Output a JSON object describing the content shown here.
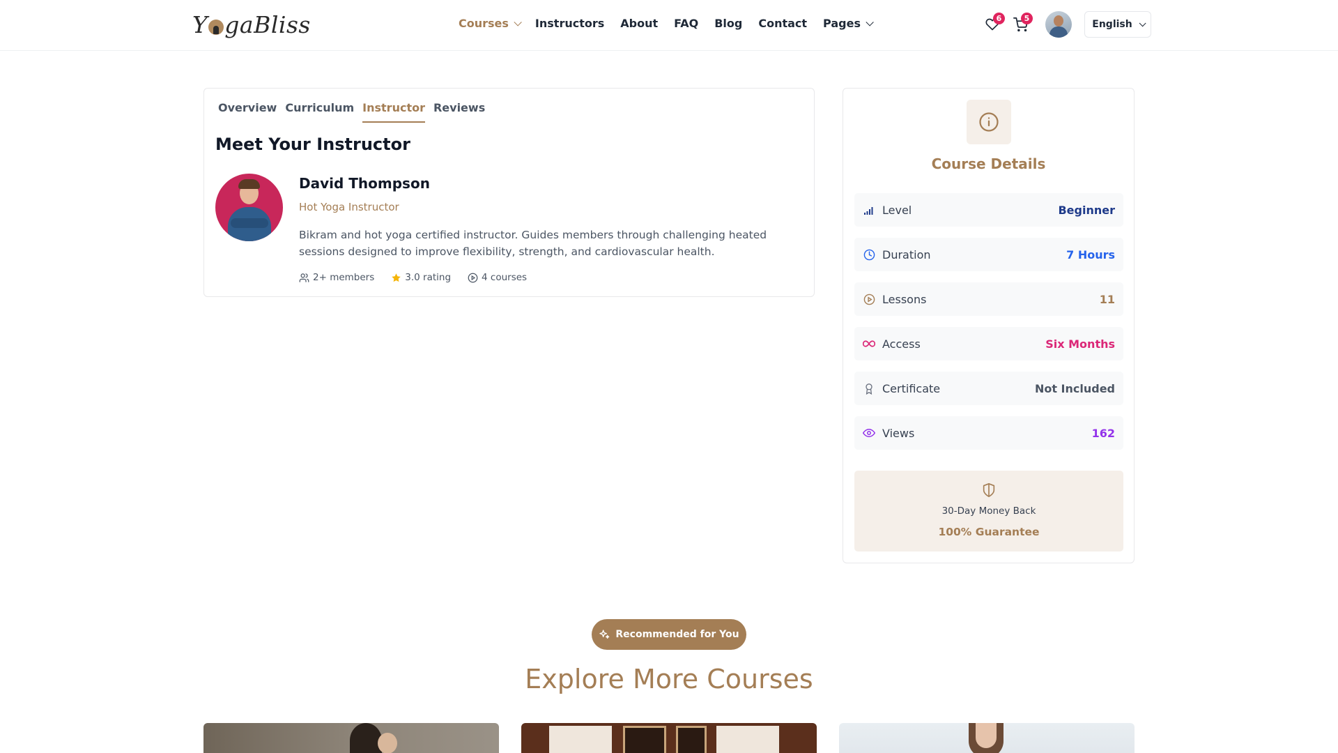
{
  "brand": {
    "name_left": "Y",
    "name_right": "gaBliss"
  },
  "nav": {
    "items": [
      {
        "label": "Courses",
        "has_dropdown": true,
        "active": true
      },
      {
        "label": "Instructors"
      },
      {
        "label": "About"
      },
      {
        "label": "FAQ"
      },
      {
        "label": "Blog"
      },
      {
        "label": "Contact"
      },
      {
        "label": "Pages",
        "has_dropdown": true
      }
    ]
  },
  "header": {
    "wishlist_count": "6",
    "cart_count": "5",
    "language": "English"
  },
  "tabs": [
    "Overview",
    "Curriculum",
    "Instructor",
    "Reviews"
  ],
  "active_tab": "Instructor",
  "instructor": {
    "section_title": "Meet Your Instructor",
    "name": "David Thompson",
    "role": "Hot Yoga Instructor",
    "bio": "Bikram and hot yoga certified instructor. Guides members through challenging heated sessions designed to improve flexibility, strength, and cardiovascular health.",
    "members": "2+ members",
    "rating": "3.0 rating",
    "courses": "4 courses"
  },
  "course_details": {
    "title": "Course Details",
    "rows": [
      {
        "label": "Level",
        "value": "Beginner",
        "icon": "signal-bars-icon",
        "color": "#1e3a8a"
      },
      {
        "label": "Duration",
        "value": "7 Hours",
        "icon": "clock-icon",
        "color": "#2563eb"
      },
      {
        "label": "Lessons",
        "value": "11",
        "icon": "play-circle-icon",
        "color": "#a47e55"
      },
      {
        "label": "Access",
        "value": "Six Months",
        "icon": "infinity-icon",
        "color": "#db2777"
      },
      {
        "label": "Certificate",
        "value": "Not Included",
        "icon": "award-icon",
        "color": "#4b5563"
      },
      {
        "label": "Views",
        "value": "162",
        "icon": "eye-icon",
        "color": "#9333ea"
      }
    ],
    "guarantee_sub": "30-Day Money Back",
    "guarantee_main": "100% Guarantee"
  },
  "recommend": {
    "pill": "Recommended for You",
    "heading": "Explore More Courses"
  },
  "colors": {
    "accent": "#a47e55",
    "badge": "#e0245e"
  }
}
